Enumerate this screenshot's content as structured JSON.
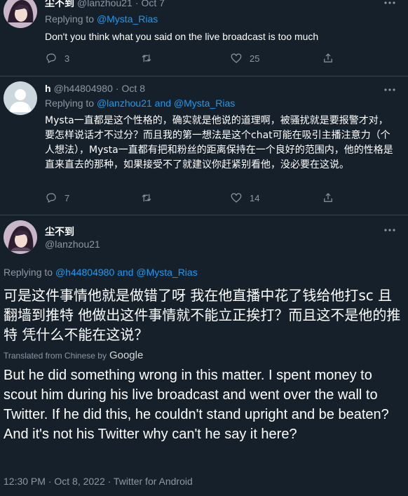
{
  "tweet1": {
    "name": "尘不到",
    "handle": "@lanzhou21",
    "date": "Oct 7",
    "replying_prefix": "Replying to",
    "replying_to": "@Mysta_Rias",
    "text": "Don't you think what you said on the live broadcast is too much",
    "replies": "3",
    "retweets": "",
    "likes": "25"
  },
  "tweet2": {
    "name": "h",
    "handle": "@h44804980",
    "date": "Oct 8",
    "replying_prefix": "Replying to",
    "replying_to": "@lanzhou21 and @Mysta_Rias",
    "text": "Mysta一直都是这个性格的，确实就是他说的道理啊，被骚扰就是要报警才对，要怎样说话才不过分？而且我的第一想法是这个chat可能在吸引主播注意力（个人想法），Mysta一直都有把和粉丝的距离保持在一个良好的范围内，他的性格是直来直去的那种，如果接受不了就建议你赶紧别看他，没必要在这说。",
    "replies": "7",
    "retweets": "",
    "likes": "14"
  },
  "main": {
    "name": "尘不到",
    "handle": "@lanzhou21",
    "replying_prefix": "Replying to",
    "replying_to": "@h44804980 and @Mysta_Rias",
    "text_zh": "可是这件事情他就是做错了呀 我在他直播中花了钱给他打sc 且翻墙到推特 他做出这件事情就不能立正挨打？而且这不是他的推特 凭什么不能在这说？",
    "translated_prefix": "Translated from Chinese by",
    "translated_by": "Google",
    "text_en": "But he did something wrong in this matter. I spent money to scout him during his live broadcast and went over the wall to Twitter. If he did this, he couldn't stand upright and be beaten? And it's not his Twitter why can't he say it here?",
    "timestamp": "12:30 PM · Oct 8, 2022 · Twitter for Android"
  },
  "more_icon": "more-horizontal",
  "colors": {
    "background": "#15202b",
    "text": "#ffffff",
    "muted": "#8b98a5",
    "accent": "#1d9bf0",
    "border": "#38444d"
  }
}
